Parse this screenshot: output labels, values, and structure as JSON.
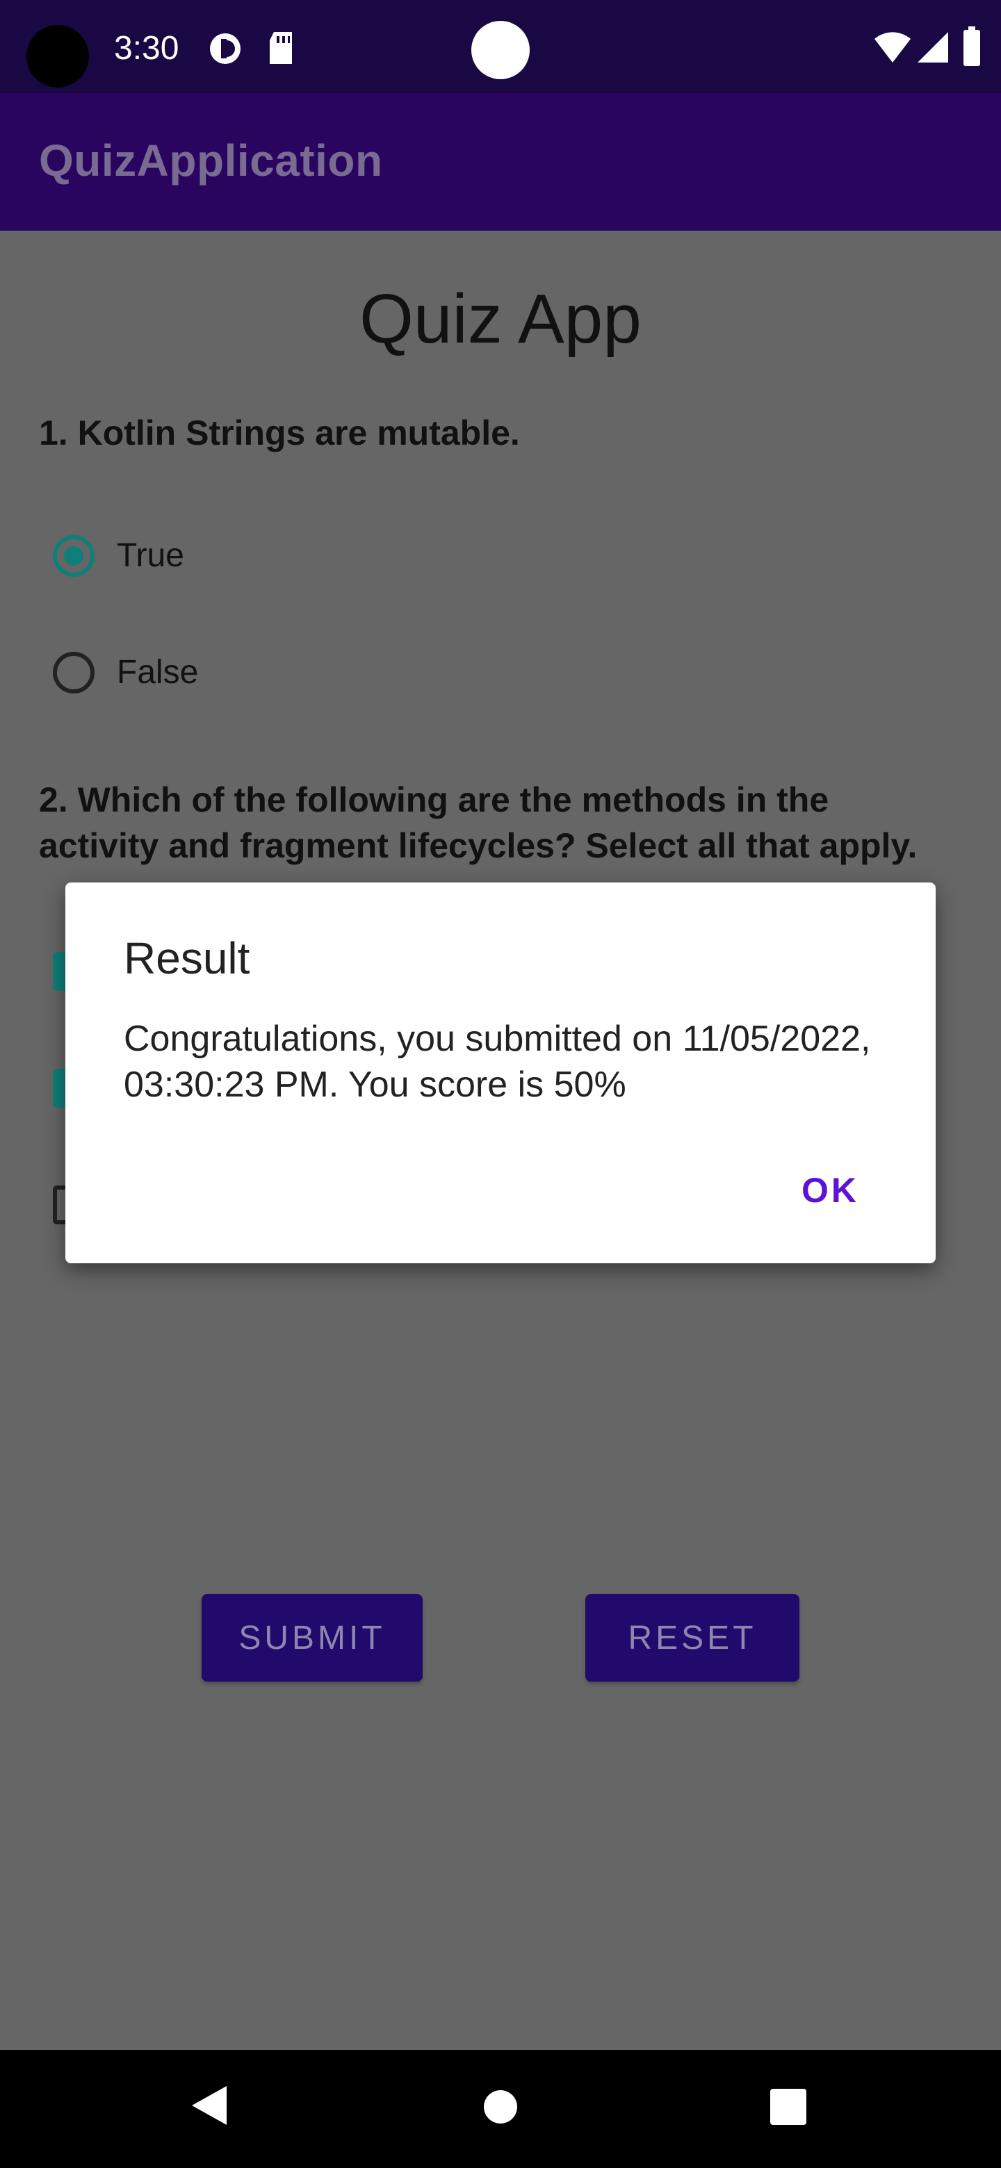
{
  "status_bar": {
    "time": "3:30",
    "icons": [
      "camera-cutout",
      "data-saver-icon",
      "sd-card-icon",
      "wifi-icon",
      "cellular-signal-icon",
      "battery-icon"
    ]
  },
  "app_bar": {
    "title": "QuizApplication"
  },
  "quiz": {
    "heading": "Quiz App",
    "question1": {
      "text": "1. Kotlin Strings are mutable.",
      "options": [
        {
          "label": "True",
          "selected": true
        },
        {
          "label": "False",
          "selected": false
        }
      ]
    },
    "question2": {
      "text": "2. Which of the following are the methods in the activity and fragment lifecycles? Select all that apply.",
      "checkboxes": [
        {
          "checked": true
        },
        {
          "checked": true
        },
        {
          "checked": false
        }
      ]
    },
    "submit_label": "SUBMIT",
    "reset_label": "RESET"
  },
  "dialog": {
    "title": "Result",
    "message": "Congratulations, you submitted on 11/05/2022, 03:30:23 PM. You score is 50%",
    "ok_label": "OK"
  },
  "colors": {
    "status_bar": "#190843",
    "app_bar": "#2a0560",
    "accent": "#0f7f7a",
    "dialog_button": "#5d12d6",
    "scrim_background": "#666666"
  },
  "nav_bar": {
    "icons": [
      "back-icon",
      "home-icon",
      "recents-icon"
    ]
  }
}
